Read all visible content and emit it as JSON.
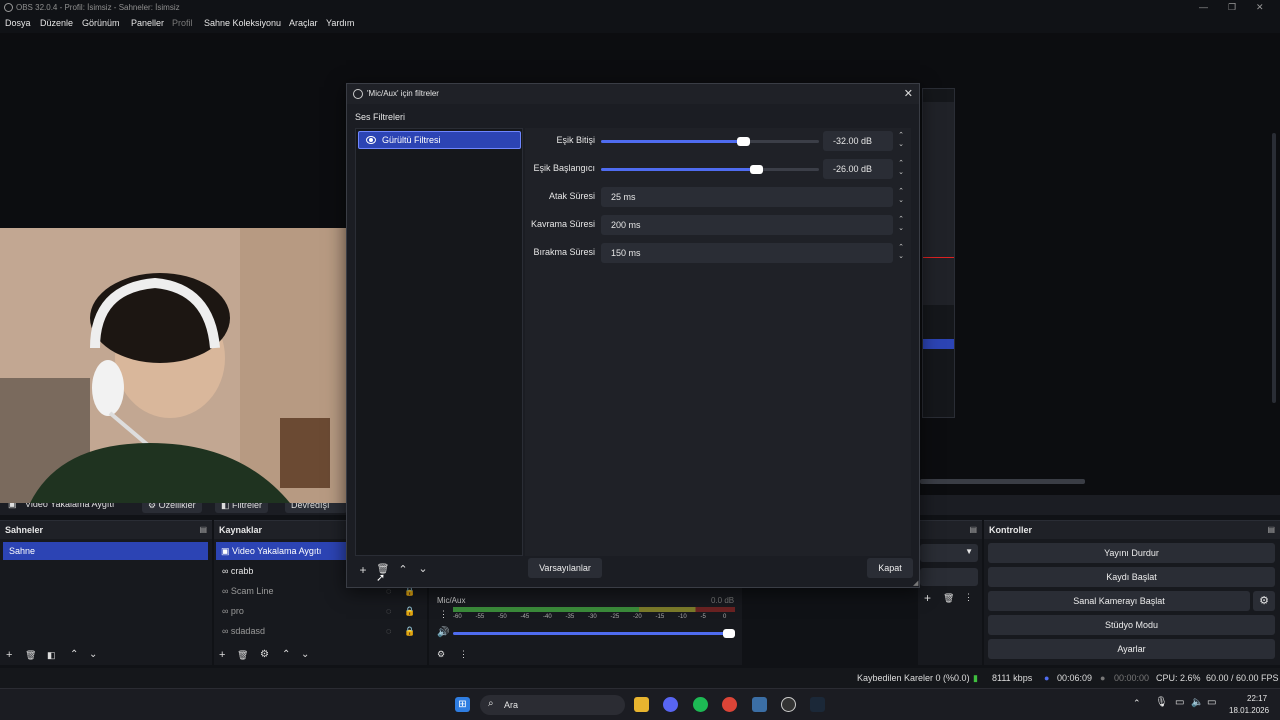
{
  "window": {
    "title": "OBS 32.0.4 - Profil: İsimsiz - Sahneler: İsimsiz"
  },
  "menu": {
    "items": [
      "Dosya",
      "Düzenle",
      "Görünüm",
      "Paneller",
      "Profil",
      "Sahne Koleksiyonu",
      "Araçlar",
      "Yardım"
    ]
  },
  "context_bar": {
    "source": "Video Yakalama Aygıtı",
    "properties": "Özellikler",
    "filters": "Filtreler",
    "deactivate": "Devredışı Bırak"
  },
  "scenes": {
    "title": "Sahneler",
    "items": [
      "Sahne"
    ]
  },
  "sources": {
    "title": "Kaynaklar",
    "items": [
      "Video Yakalama Aygıtı",
      "crabb",
      "Scam Line",
      "pro",
      "sdadasd"
    ]
  },
  "mixer": {
    "channel": "Mic/Aux",
    "level": "0.0 dB",
    "scale": [
      "-60",
      "-55",
      "-50",
      "-45",
      "-40",
      "-35",
      "-30",
      "-25",
      "-20",
      "-15",
      "-10",
      "-5",
      "0"
    ]
  },
  "controls": {
    "title": "Kontroller",
    "stop_stream": "Yayını Durdur",
    "start_record": "Kaydı Başlat",
    "virtual_cam": "Sanal Kamerayı Başlat",
    "studio": "Stüdyo Modu",
    "settings": "Ayarlar"
  },
  "status": {
    "dropped": "Kaybedilen Kareler 0 (%0.0)",
    "bitrate": "8111 kbps",
    "stream_time": "00:06:09",
    "rec_time": "00:00:00",
    "cpu": "CPU: 2.6%",
    "fps": "60.00 / 60.00 FPS"
  },
  "taskbar": {
    "search": "Ara",
    "time": "22:17",
    "date": "18.01.2026"
  },
  "dialog": {
    "title": "'Mic/Aux' için filtreler",
    "section": "Ses Filtreleri",
    "filter_name": "Gürültü Filtresi",
    "fields": {
      "close_threshold": {
        "label": "Eşik Bitişi",
        "value": "-32.00 dB",
        "fraction": 0.65
      },
      "open_threshold": {
        "label": "Eşik Başlangıcı",
        "value": "-26.00 dB",
        "fraction": 0.71
      },
      "attack": {
        "label": "Atak Süresi",
        "value": "25 ms"
      },
      "hold": {
        "label": "Kavrama Süresi",
        "value": "200 ms"
      },
      "release": {
        "label": "Bırakma Süresi",
        "value": "150 ms"
      }
    },
    "defaults": "Varsayılanlar",
    "close": "Kapat"
  },
  "colors": {
    "accent": "#2c44b4",
    "slider": "#4f6cf0"
  }
}
